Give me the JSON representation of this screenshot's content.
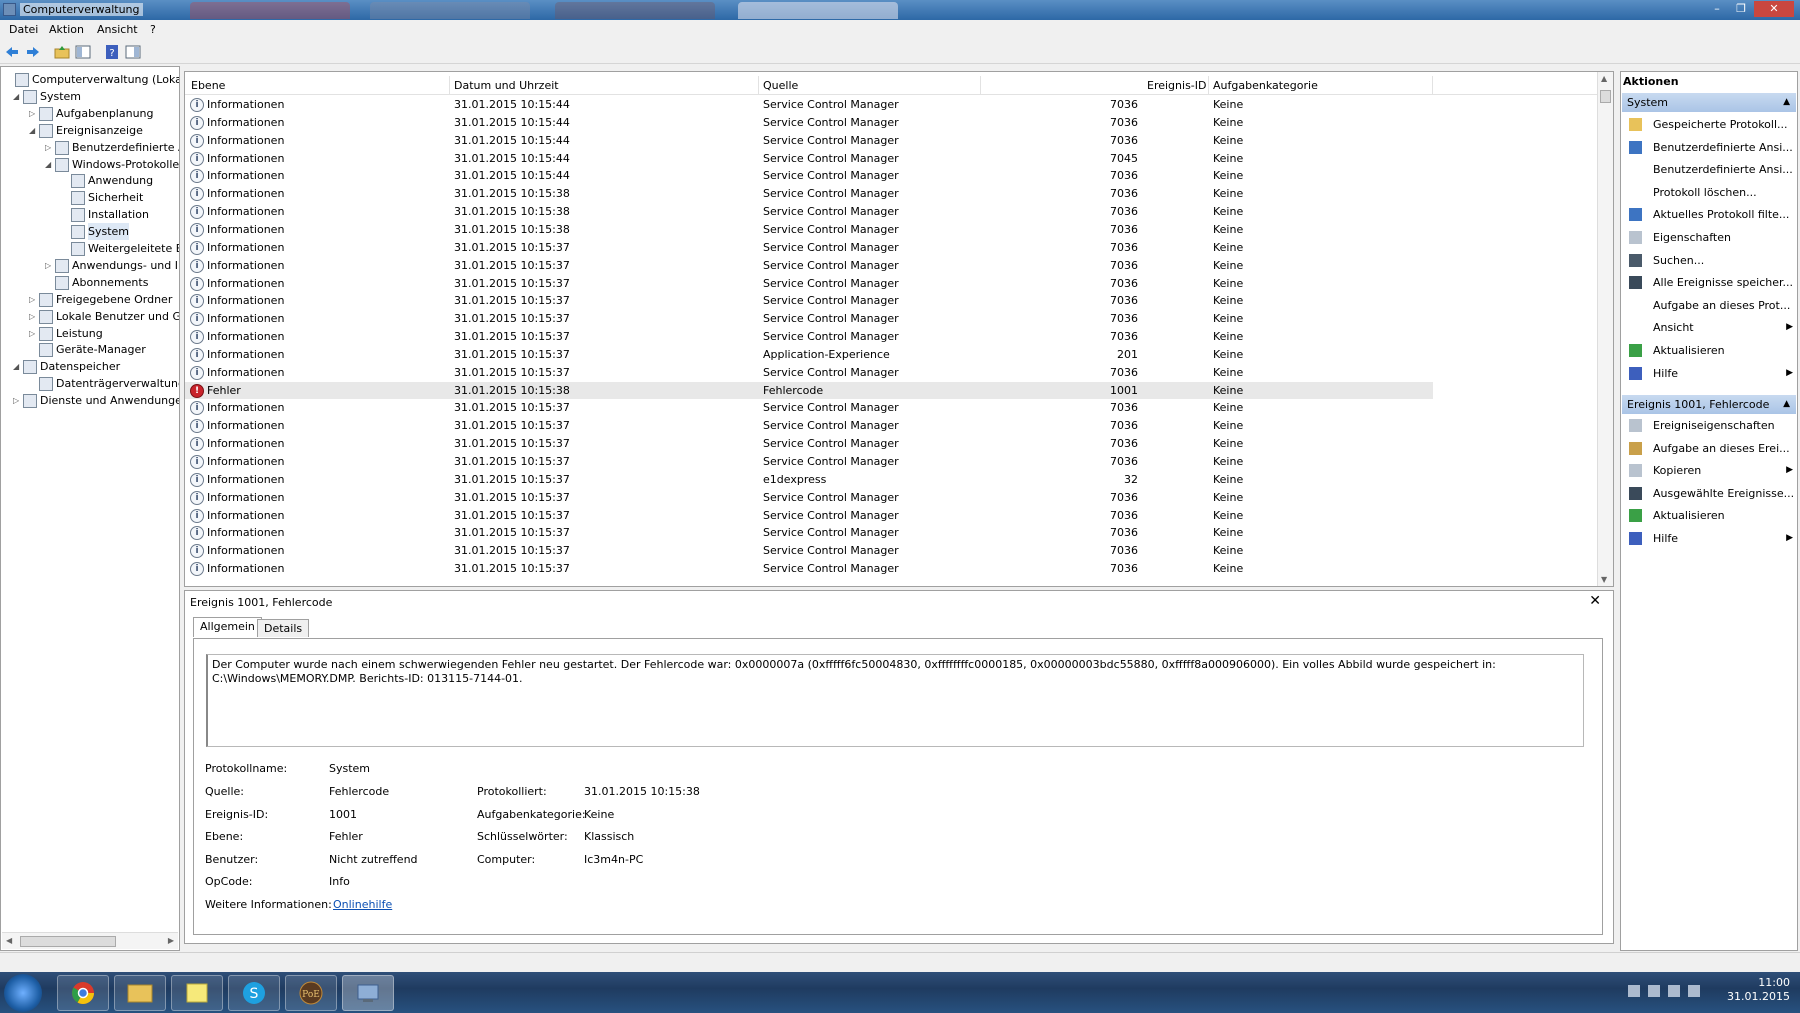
{
  "window": {
    "title": "Computerverwaltung"
  },
  "menu": [
    "Datei",
    "Aktion",
    "Ansicht",
    "?"
  ],
  "tree": [
    {
      "label": "Computerverwaltung (Lokal)",
      "level": 0,
      "expander": ""
    },
    {
      "label": "System",
      "level": 1,
      "expander": "◢"
    },
    {
      "label": "Aufgabenplanung",
      "level": 2,
      "expander": "▷"
    },
    {
      "label": "Ereignisanzeige",
      "level": 2,
      "expander": "◢"
    },
    {
      "label": "Benutzerdefinierte A",
      "level": 3,
      "expander": "▷"
    },
    {
      "label": "Windows-Protokolle",
      "level": 3,
      "expander": "◢"
    },
    {
      "label": "Anwendung",
      "level": 4,
      "expander": ""
    },
    {
      "label": "Sicherheit",
      "level": 4,
      "expander": ""
    },
    {
      "label": "Installation",
      "level": 4,
      "expander": ""
    },
    {
      "label": "System",
      "level": 4,
      "expander": "",
      "selected": true
    },
    {
      "label": "Weitergeleitete E",
      "level": 4,
      "expander": ""
    },
    {
      "label": "Anwendungs- und I",
      "level": 3,
      "expander": "▷"
    },
    {
      "label": "Abonnements",
      "level": 3,
      "expander": ""
    },
    {
      "label": "Freigegebene Ordner",
      "level": 2,
      "expander": "▷"
    },
    {
      "label": "Lokale Benutzer und Gr",
      "level": 2,
      "expander": "▷"
    },
    {
      "label": "Leistung",
      "level": 2,
      "expander": "▷"
    },
    {
      "label": "Geräte-Manager",
      "level": 2,
      "expander": ""
    },
    {
      "label": "Datenspeicher",
      "level": 1,
      "expander": "◢"
    },
    {
      "label": "Datenträgerverwaltung",
      "level": 2,
      "expander": ""
    },
    {
      "label": "Dienste und Anwendungen",
      "level": 1,
      "expander": "▷"
    }
  ],
  "columns": {
    "level": "Ebene",
    "datetime": "Datum und Uhrzeit",
    "source": "Quelle",
    "event_id": "Ereignis-ID",
    "category": "Aufgabenkategorie"
  },
  "events": [
    {
      "level": "Informationen",
      "datetime": "31.01.2015 10:15:44",
      "source": "Service Control Manager",
      "id": "7036",
      "category": "Keine"
    },
    {
      "level": "Informationen",
      "datetime": "31.01.2015 10:15:44",
      "source": "Service Control Manager",
      "id": "7036",
      "category": "Keine"
    },
    {
      "level": "Informationen",
      "datetime": "31.01.2015 10:15:44",
      "source": "Service Control Manager",
      "id": "7036",
      "category": "Keine"
    },
    {
      "level": "Informationen",
      "datetime": "31.01.2015 10:15:44",
      "source": "Service Control Manager",
      "id": "7045",
      "category": "Keine"
    },
    {
      "level": "Informationen",
      "datetime": "31.01.2015 10:15:44",
      "source": "Service Control Manager",
      "id": "7036",
      "category": "Keine"
    },
    {
      "level": "Informationen",
      "datetime": "31.01.2015 10:15:38",
      "source": "Service Control Manager",
      "id": "7036",
      "category": "Keine"
    },
    {
      "level": "Informationen",
      "datetime": "31.01.2015 10:15:38",
      "source": "Service Control Manager",
      "id": "7036",
      "category": "Keine"
    },
    {
      "level": "Informationen",
      "datetime": "31.01.2015 10:15:38",
      "source": "Service Control Manager",
      "id": "7036",
      "category": "Keine"
    },
    {
      "level": "Informationen",
      "datetime": "31.01.2015 10:15:37",
      "source": "Service Control Manager",
      "id": "7036",
      "category": "Keine"
    },
    {
      "level": "Informationen",
      "datetime": "31.01.2015 10:15:37",
      "source": "Service Control Manager",
      "id": "7036",
      "category": "Keine"
    },
    {
      "level": "Informationen",
      "datetime": "31.01.2015 10:15:37",
      "source": "Service Control Manager",
      "id": "7036",
      "category": "Keine"
    },
    {
      "level": "Informationen",
      "datetime": "31.01.2015 10:15:37",
      "source": "Service Control Manager",
      "id": "7036",
      "category": "Keine"
    },
    {
      "level": "Informationen",
      "datetime": "31.01.2015 10:15:37",
      "source": "Service Control Manager",
      "id": "7036",
      "category": "Keine"
    },
    {
      "level": "Informationen",
      "datetime": "31.01.2015 10:15:37",
      "source": "Service Control Manager",
      "id": "7036",
      "category": "Keine"
    },
    {
      "level": "Informationen",
      "datetime": "31.01.2015 10:15:37",
      "source": "Application-Experience",
      "id": "201",
      "category": "Keine"
    },
    {
      "level": "Informationen",
      "datetime": "31.01.2015 10:15:37",
      "source": "Service Control Manager",
      "id": "7036",
      "category": "Keine"
    },
    {
      "level": "Fehler",
      "datetime": "31.01.2015 10:15:38",
      "source": "Fehlercode",
      "id": "1001",
      "category": "Keine",
      "error": true,
      "selected": true
    },
    {
      "level": "Informationen",
      "datetime": "31.01.2015 10:15:37",
      "source": "Service Control Manager",
      "id": "7036",
      "category": "Keine"
    },
    {
      "level": "Informationen",
      "datetime": "31.01.2015 10:15:37",
      "source": "Service Control Manager",
      "id": "7036",
      "category": "Keine"
    },
    {
      "level": "Informationen",
      "datetime": "31.01.2015 10:15:37",
      "source": "Service Control Manager",
      "id": "7036",
      "category": "Keine"
    },
    {
      "level": "Informationen",
      "datetime": "31.01.2015 10:15:37",
      "source": "Service Control Manager",
      "id": "7036",
      "category": "Keine"
    },
    {
      "level": "Informationen",
      "datetime": "31.01.2015 10:15:37",
      "source": "e1dexpress",
      "id": "32",
      "category": "Keine"
    },
    {
      "level": "Informationen",
      "datetime": "31.01.2015 10:15:37",
      "source": "Service Control Manager",
      "id": "7036",
      "category": "Keine"
    },
    {
      "level": "Informationen",
      "datetime": "31.01.2015 10:15:37",
      "source": "Service Control Manager",
      "id": "7036",
      "category": "Keine"
    },
    {
      "level": "Informationen",
      "datetime": "31.01.2015 10:15:37",
      "source": "Service Control Manager",
      "id": "7036",
      "category": "Keine"
    },
    {
      "level": "Informationen",
      "datetime": "31.01.2015 10:15:37",
      "source": "Service Control Manager",
      "id": "7036",
      "category": "Keine"
    },
    {
      "level": "Informationen",
      "datetime": "31.01.2015 10:15:37",
      "source": "Service Control Manager",
      "id": "7036",
      "category": "Keine"
    }
  ],
  "detail": {
    "title": "Ereignis 1001, Fehlercode",
    "close": "✕",
    "tabs": [
      "Allgemein",
      "Details"
    ],
    "message": "Der Computer wurde nach einem schwerwiegenden Fehler neu gestartet. Der Fehlercode war: 0x0000007a (0xfffff6fc50004830, 0xffffffffc0000185, 0x00000003bdc55880, 0xfffff8a000906000). Ein volles Abbild wurde gespeichert in: C:\\Windows\\MEMORY.DMP. Berichts-ID: 013115-7144-01.",
    "fields": {
      "protokollname_label": "Protokollname:",
      "protokollname": "System",
      "quelle_label": "Quelle:",
      "quelle": "Fehlercode",
      "ereignis_id_label": "Ereignis-ID:",
      "ereignis_id": "1001",
      "ebene_label": "Ebene:",
      "ebene": "Fehler",
      "benutzer_label": "Benutzer:",
      "benutzer": "Nicht zutreffend",
      "opcode_label": "OpCode:",
      "opcode": "Info",
      "weitere_label": "Weitere Informationen:",
      "weitere_link": "Onlinehilfe",
      "protokolliert_label": "Protokolliert:",
      "protokolliert": "31.01.2015 10:15:38",
      "aufgabenkategorie_label": "Aufgabenkategorie:",
      "aufgabenkategorie": "Keine",
      "schluesselwoerter_label": "Schlüsselwörter:",
      "schluesselwoerter": "Klassisch",
      "computer_label": "Computer:",
      "computer": "Ic3m4n-PC"
    }
  },
  "actions": {
    "header": "Aktionen",
    "section1": "System",
    "items1": [
      {
        "label": "Gespeicherte Protokoll...",
        "icon": "folder-open-icon"
      },
      {
        "label": "Benutzerdefinierte Ansi...",
        "icon": "filter-icon"
      },
      {
        "label": "Benutzerdefinierte Ansi...",
        "icon": ""
      },
      {
        "label": "Protokoll löschen...",
        "icon": ""
      },
      {
        "label": "Aktuelles Protokoll filte...",
        "icon": "filter-icon"
      },
      {
        "label": "Eigenschaften",
        "icon": "properties-icon"
      },
      {
        "label": "Suchen...",
        "icon": "binoculars-icon"
      },
      {
        "label": "Alle Ereignisse speicher...",
        "icon": "save-icon"
      },
      {
        "label": "Aufgabe an dieses Prot...",
        "icon": ""
      },
      {
        "label": "Ansicht",
        "icon": "",
        "submenu": true
      },
      {
        "label": "Aktualisieren",
        "icon": "refresh-icon"
      },
      {
        "label": "Hilfe",
        "icon": "help-icon",
        "submenu": true
      }
    ],
    "section2": "Ereignis 1001, Fehlercode",
    "items2": [
      {
        "label": "Ereigniseigenschaften",
        "icon": "properties-icon"
      },
      {
        "label": "Aufgabe an dieses Erei...",
        "icon": "task-icon"
      },
      {
        "label": "Kopieren",
        "icon": "copy-icon",
        "submenu": true
      },
      {
        "label": "Ausgewählte Ereignisse...",
        "icon": "save-icon"
      },
      {
        "label": "Aktualisieren",
        "icon": "refresh-icon"
      },
      {
        "label": "Hilfe",
        "icon": "help-icon",
        "submenu": true
      }
    ]
  },
  "taskbar": {
    "time": "11:00",
    "date": "31.01.2015"
  }
}
